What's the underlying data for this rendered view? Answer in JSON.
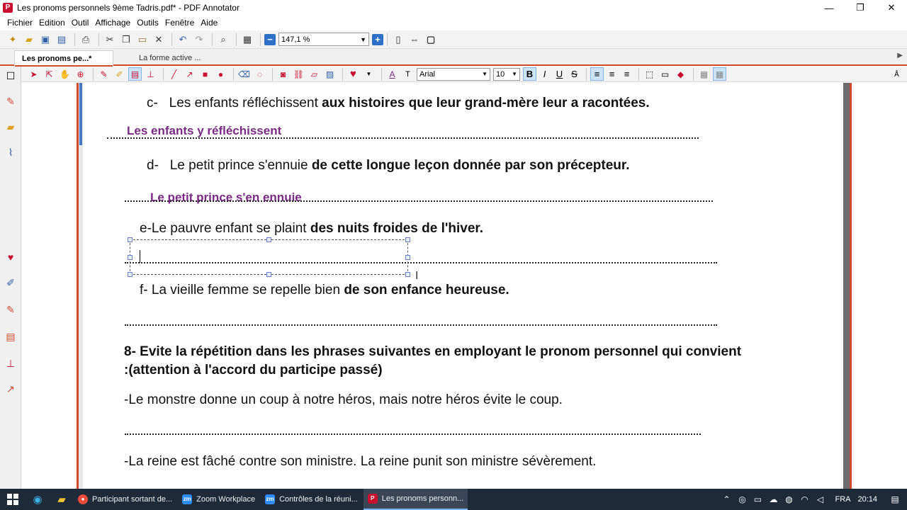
{
  "window": {
    "title": "Les pronoms personnels 9ème Tadris.pdf* - PDF Annotator",
    "app_icon": "pdf-annotator-icon",
    "minimize": "—",
    "maximize": "❐",
    "close": "✕"
  },
  "menu": [
    "Fichier",
    "Edition",
    "Outil",
    "Affichage",
    "Outils",
    "Fenêtre",
    "Aide"
  ],
  "toolbar": {
    "zoom_value": "147,1 %",
    "zoom_minus": "−",
    "zoom_plus": "+"
  },
  "tabs": {
    "active": "Les pronoms pe...*",
    "inactive": "La forme active ..."
  },
  "annotation_toolbar": {
    "font_name": "Arial",
    "font_size": "10",
    "bold": "B",
    "italic": "I",
    "underline": "U",
    "strike": "S"
  },
  "document": {
    "c_prefix": "c-   Les enfants réfléchissent ",
    "c_bold": "aux histoires que leur grand-mère leur a racontées.",
    "c_answer": "Les enfants y réfléchissent",
    "d_prefix": "d-   Le petit prince s'ennuie ",
    "d_bold": "de cette longue leçon donnée par son précepteur.",
    "d_answer": "Le petit prince s'en ennuie",
    "e_prefix": "e-Le pauvre enfant se plaint ",
    "e_bold": "des nuits froides de l'hiver.",
    "f_prefix": "f- La vieille femme se repelle bien ",
    "f_bold": "de son enfance heureuse.",
    "q8_line1": "8- Evite la répétition dans les phrases suivantes en employant le pronom personnel qui convient",
    "q8_line2": ":(attention à l'accord du participe passé)",
    "s1": "-Le monstre donne un coup à notre héros, mais notre héros évite le coup.",
    "s2": "-La reine est fâché contre son ministre. La reine punit son ministre sévèrement."
  },
  "taskbar": {
    "tasks": [
      {
        "label": "Participant sortant de...",
        "icon": "chrome-icon"
      },
      {
        "label": "Zoom Workplace",
        "icon": "zoom-icon"
      },
      {
        "label": "Contrôles de la réuni...",
        "icon": "zoom-icon"
      },
      {
        "label": "Les pronoms personn...",
        "icon": "pdf-annotator-icon"
      }
    ],
    "language": "FRA",
    "time": "20:14"
  },
  "colors": {
    "accent": "#d24a2c",
    "answer_text": "#7b2a86",
    "taskbar": "#1f2a38"
  }
}
